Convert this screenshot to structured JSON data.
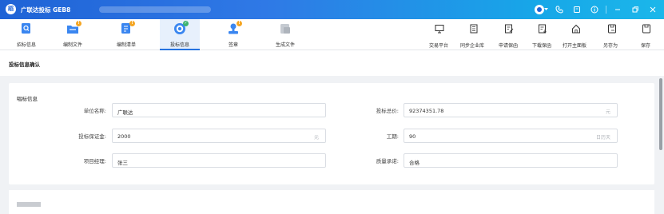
{
  "app": {
    "logo": "蹈",
    "title": "广联达投标 GEB8"
  },
  "toolbar": {
    "tools": [
      {
        "label": "招标信息"
      },
      {
        "label": "编制文件"
      },
      {
        "label": "编制清单"
      },
      {
        "label": "投标信息"
      },
      {
        "label": "签章"
      },
      {
        "label": "生成文件"
      }
    ],
    "right_tools": [
      {
        "label": "交易平台"
      },
      {
        "label": "同步企业库"
      },
      {
        "label": "申请保函"
      },
      {
        "label": "下载保函"
      },
      {
        "label": "打开主面板"
      },
      {
        "label": "另存为"
      },
      {
        "label": "保存"
      }
    ]
  },
  "crumb": {
    "text": "投标信息确认"
  },
  "bid": {
    "section_title": "唱标信息",
    "unit_name_label": "单位名称:",
    "unit_name_value": "广联达",
    "total_price_label": "投标总价:",
    "total_price_value": "92374351.78",
    "total_price_unit": "元",
    "deposit_label": "投标保证金:",
    "deposit_value": "2000",
    "deposit_unit": "元",
    "duration_label": "工期:",
    "duration_value": "90",
    "duration_unit": "日历天",
    "manager_label": "项目经理:",
    "manager_value": "张三",
    "quality_label": "质量承诺:",
    "quality_value": "合格"
  },
  "colors": {
    "accent": "#2673e0",
    "badge_warning": "#f5a623",
    "badge_ok": "#3cb371"
  }
}
